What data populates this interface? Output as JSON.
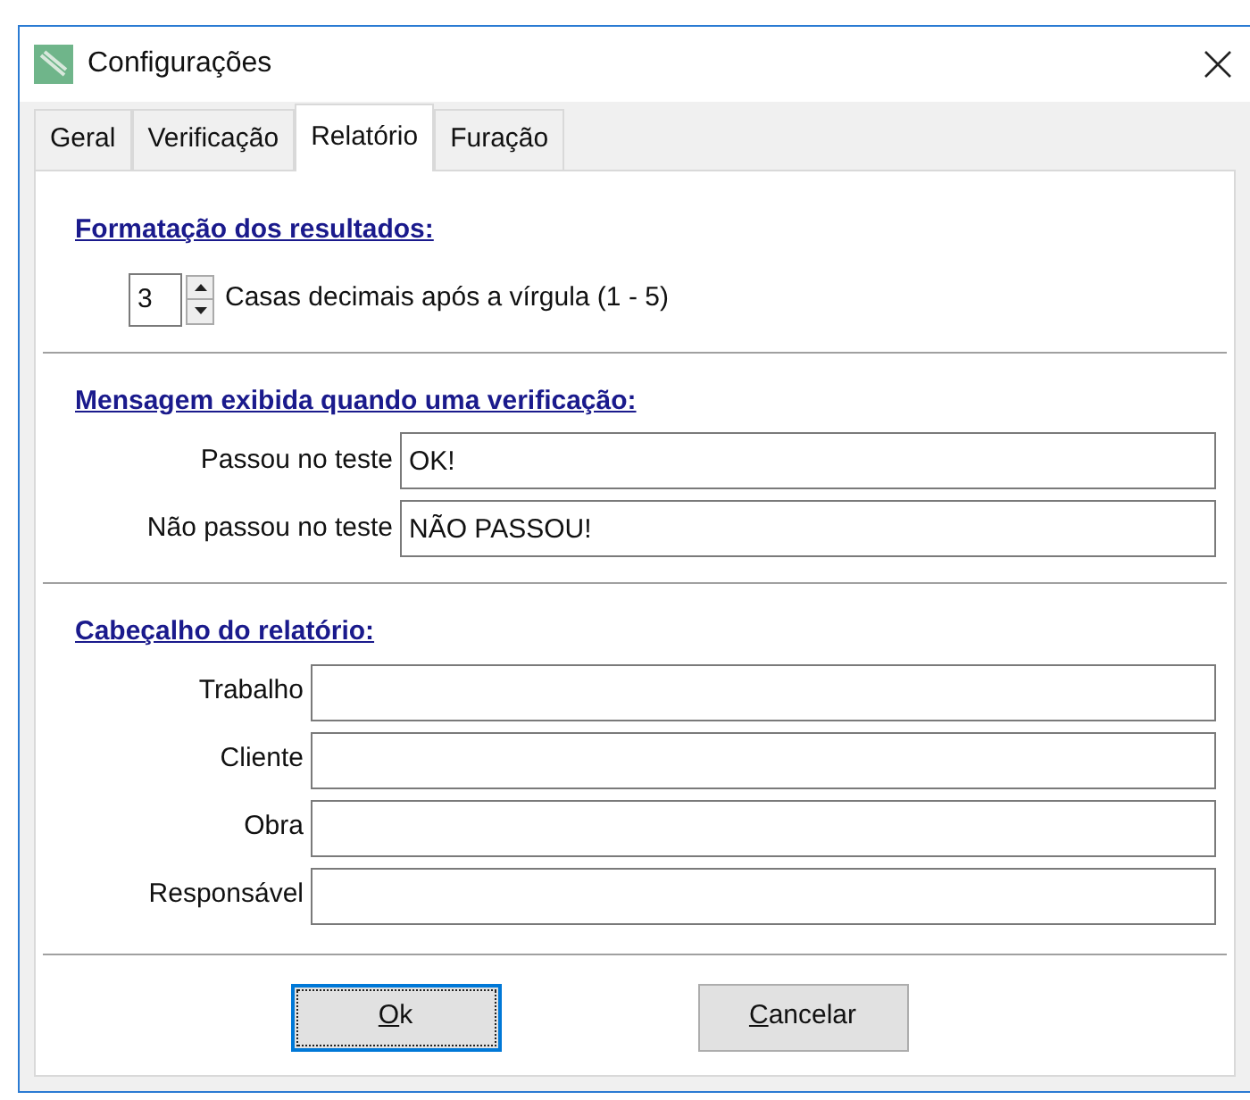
{
  "window": {
    "title": "Configurações"
  },
  "tabs": [
    {
      "label": "Geral",
      "selected": false
    },
    {
      "label": "Verificação",
      "selected": false
    },
    {
      "label": "Relatório",
      "selected": true
    },
    {
      "label": "Furação",
      "selected": false
    }
  ],
  "formatting": {
    "heading": "Formatação dos resultados:",
    "decimals": {
      "value": "3",
      "label": "Casas decimais após a vírgula (1 - 5)"
    }
  },
  "message": {
    "heading": "Mensagem exibida quando uma verificação:",
    "fields": [
      {
        "label": "Passou no teste",
        "value": "OK!"
      },
      {
        "label": "Não passou no teste",
        "value": "NÃO PASSOU!"
      }
    ]
  },
  "header": {
    "heading": "Cabeçalho do relatório:",
    "fields": [
      {
        "label": "Trabalho"
      },
      {
        "label": "Cliente"
      },
      {
        "label": "Obra"
      },
      {
        "label": "Responsável"
      }
    ]
  },
  "buttons": [
    {
      "label": "Ok",
      "focused": true,
      "access_key_underlined": true
    },
    {
      "label": "Cancelar",
      "focused": false,
      "access_key_underlined": true
    }
  ]
}
